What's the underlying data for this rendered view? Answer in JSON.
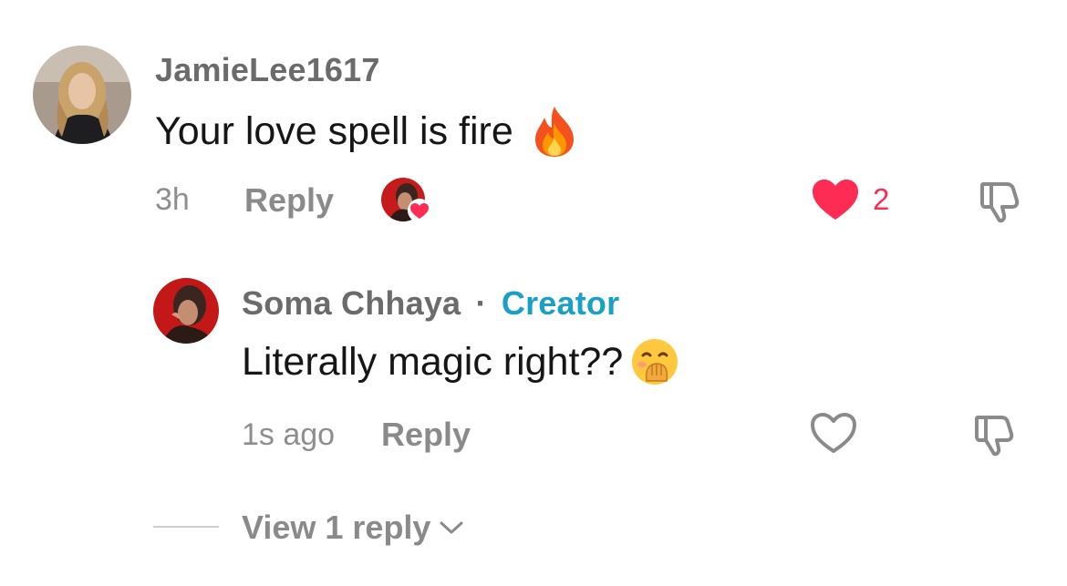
{
  "comment": {
    "username": "JamieLee1617",
    "text": "Your love spell is fire",
    "emoji_icon": "fire-emoji",
    "time": "3h",
    "reply_label": "Reply",
    "creator_liked_icon": "creator-liked-avatar-icon",
    "like_count": "2",
    "liked": true,
    "dislike_icon": "thumbs-down-icon"
  },
  "reply": {
    "username": "Soma Chhaya",
    "separator": "·",
    "badge": "Creator",
    "text": "Literally magic right??",
    "emoji_icon": "hand-over-mouth-emoji",
    "time": "1s ago",
    "reply_label": "Reply",
    "liked": false,
    "dislike_icon": "thumbs-down-icon"
  },
  "view_replies": {
    "label": "View 1 reply",
    "icon": "chevron-down-icon"
  },
  "colors": {
    "like_red": "#fe2c55",
    "creator_blue": "#1aa0c7",
    "username_gray": "#6b6b6b",
    "meta_gray": "#8e8e8e"
  }
}
